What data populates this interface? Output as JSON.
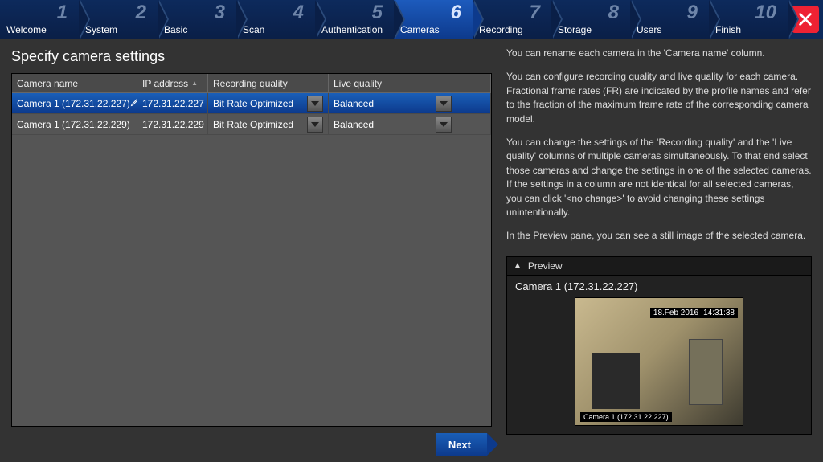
{
  "wizard": {
    "steps": [
      {
        "num": "1",
        "label": "Welcome"
      },
      {
        "num": "2",
        "label": "System"
      },
      {
        "num": "3",
        "label": "Basic"
      },
      {
        "num": "4",
        "label": "Scan"
      },
      {
        "num": "5",
        "label": "Authentication"
      },
      {
        "num": "6",
        "label": "Cameras"
      },
      {
        "num": "7",
        "label": "Recording"
      },
      {
        "num": "8",
        "label": "Storage"
      },
      {
        "num": "9",
        "label": "Users"
      },
      {
        "num": "10",
        "label": "Finish"
      }
    ],
    "active_index": 5
  },
  "heading": "Specify camera settings",
  "columns": {
    "name": "Camera name",
    "ip": "IP address",
    "rec": "Recording quality",
    "live": "Live quality"
  },
  "rows": [
    {
      "name": "Camera 1 (172.31.22.227)",
      "ip": "172.31.22.227",
      "rec": "Bit Rate Optimized",
      "live": "Balanced",
      "selected": true
    },
    {
      "name": "Camera 1 (172.31.22.229)",
      "ip": "172.31.22.229",
      "rec": "Bit Rate Optimized",
      "live": "Balanced",
      "selected": false
    }
  ],
  "next_label": "Next",
  "help": {
    "p1": "You can rename each camera in the 'Camera name' column.",
    "p2": "You can configure recording quality and live quality for each camera. Fractional frame rates (FR) are indicated by the profile names and refer to the fraction of the maximum frame rate of the corresponding camera model.",
    "p3": "You can change the settings of the 'Recording quality' and the 'Live quality' columns of multiple cameras simultaneously. To that end select those cameras and change the settings in one of the selected cameras. If the settings in a column are not identical for all selected cameras, you can click '<no change>' to avoid changing these settings unintentionally.",
    "p4": "In the Preview pane, you can see a still image of the selected camera."
  },
  "preview": {
    "header": "Preview",
    "title": "Camera 1 (172.31.22.227)",
    "stamp_date": "18.Feb 2016",
    "stamp_time": "14:31:38",
    "overlay": "Camera 1 (172.31.22.227)"
  }
}
